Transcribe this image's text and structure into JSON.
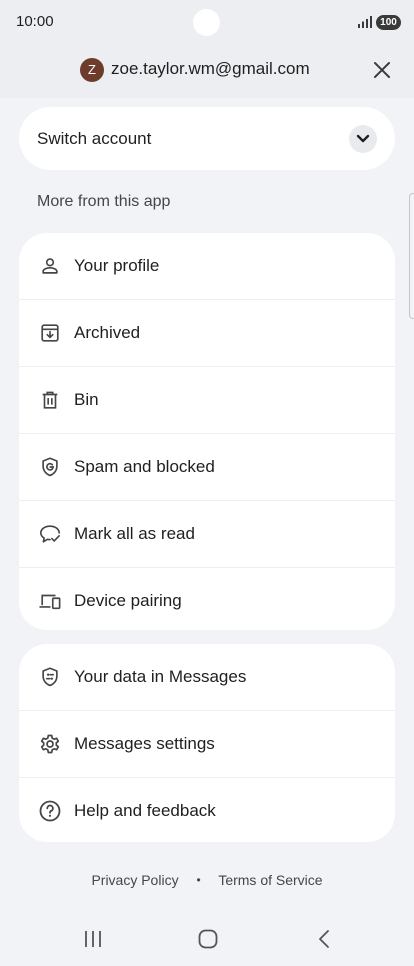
{
  "status_bar": {
    "time": "10:00",
    "battery": "100",
    "signal_icon": "signal-icon"
  },
  "header": {
    "avatar_letter": "Z",
    "avatar_color": "#6d3c2c",
    "email": "zoe.taylor.wm@gmail.com",
    "close_icon": "close-icon"
  },
  "switch_account": {
    "label": "Switch account",
    "icon": "chevron-down-icon"
  },
  "section": {
    "label": "More from this app"
  },
  "menu_group_1": [
    {
      "label": "Your profile",
      "icon": "person-icon"
    },
    {
      "label": "Archived",
      "icon": "archive-icon"
    },
    {
      "label": "Bin",
      "icon": "trash-icon"
    },
    {
      "label": "Spam and blocked",
      "icon": "shield-g-icon"
    },
    {
      "label": "Mark all as read",
      "icon": "chat-check-icon"
    },
    {
      "label": "Device pairing",
      "icon": "devices-icon"
    }
  ],
  "menu_group_2": [
    {
      "label": "Your data in Messages",
      "icon": "shield-data-icon"
    },
    {
      "label": "Messages settings",
      "icon": "gear-icon"
    },
    {
      "label": "Help and feedback",
      "icon": "help-icon"
    }
  ],
  "footer": {
    "privacy": "Privacy Policy",
    "separator": "•",
    "terms": "Terms of Service"
  },
  "nav_bar": {
    "recents_icon": "recents-icon",
    "home_icon": "home-icon",
    "back_icon": "back-icon"
  }
}
